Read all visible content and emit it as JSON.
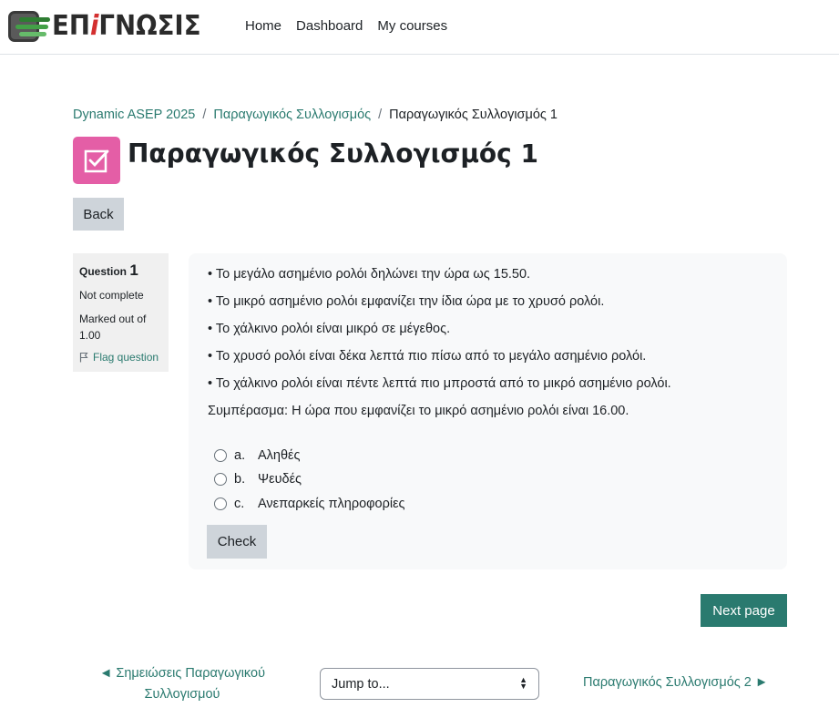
{
  "brand": {
    "logo_prefix": "ΕΠ",
    "logo_i": "i",
    "logo_suffix": "ΓΝΩΣΙΣ"
  },
  "nav": {
    "home": "Home",
    "dashboard": "Dashboard",
    "my_courses": "My courses"
  },
  "breadcrumb": {
    "items": [
      "Dynamic ASEP 2025",
      "Παραγωγικός Συλλογισμός"
    ],
    "current": "Παραγωγικός Συλλογισμός 1",
    "separator": "/"
  },
  "page_title": "Παραγωγικός Συλλογισμός 1",
  "back_label": "Back",
  "question_info": {
    "question_label": "Question",
    "question_number": "1",
    "state": "Not complete",
    "grade": "Marked out of 1.00",
    "flag_label": "Flag question"
  },
  "question": {
    "lines": [
      "• Το μεγάλο ασημένιο ρολόι δηλώνει την ώρα ως 15.50.",
      "• Το μικρό ασημένιο ρολόι εμφανίζει την ίδια ώρα με το χρυσό ρολόι.",
      "• Το χάλκινο ρολόι είναι μικρό σε μέγεθος.",
      "• Το χρυσό ρολόι είναι δέκα λεπτά πιο πίσω από το μεγάλο ασημένιο ρολόι.",
      "• Το χάλκινο ρολόι είναι πέντε λεπτά πιο μπροστά από το μικρό ασημένιο ρολόι."
    ],
    "conclusion": "Συμπέρασμα: Η ώρα που εμφανίζει το μικρό ασημένιο ρολόι είναι 16.00.",
    "answers": [
      {
        "letter": "a.",
        "text": "Αληθές"
      },
      {
        "letter": "b.",
        "text": "Ψευδές"
      },
      {
        "letter": "c.",
        "text": "Ανεπαρκείς πληροφορίες"
      }
    ],
    "check_label": "Check"
  },
  "next_page_label": "Next page",
  "activity_nav": {
    "prev_line1": "◄ Σημειώσεις Παραγωγικού",
    "prev_line2": "Συλλογισμού",
    "jump_label": "Jump to...",
    "next": "Παραγωγικός Συλλογισμός 2 ►"
  },
  "colors": {
    "accent": "#2a7a6f",
    "quiz_icon": "#e45ea6",
    "panel_bg": "#f8f9fa"
  },
  "icons": {
    "quiz": "checkbox-icon",
    "flag": "flag-icon",
    "caret": "sort-caret-icon"
  }
}
